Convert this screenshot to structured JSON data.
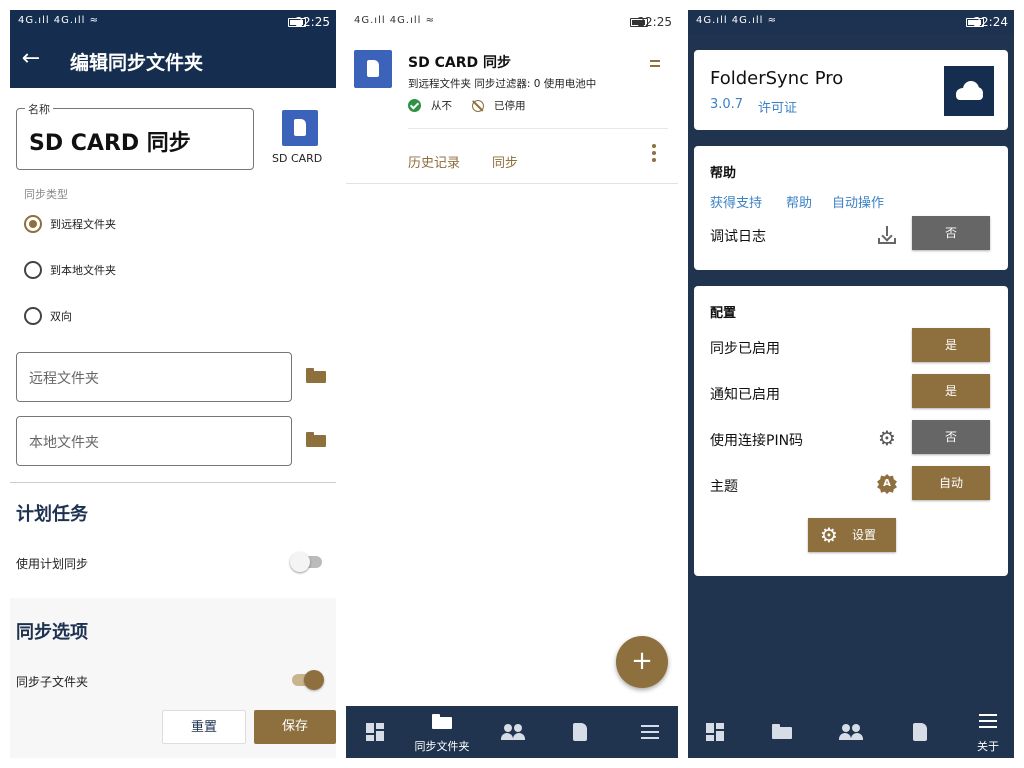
{
  "status": {
    "signal": "4G.ıll 4G.ıll ≈",
    "time_left": "22:25",
    "time_mid": "22:25",
    "time_right": "22:24"
  },
  "edit": {
    "title": "编辑同步文件夹",
    "name_label": "名称",
    "name_value": "SD CARD 同步",
    "icon_caption": "SD CARD",
    "sync_type_label": "同步类型",
    "radio_options": [
      "到远程文件夹",
      "到本地文件夹",
      "双向"
    ],
    "remote_folder_placeholder": "远程文件夹",
    "local_folder_placeholder": "本地文件夹",
    "schedule_heading": "计划任务",
    "use_schedule_label": "使用计划同步",
    "sync_options_heading": "同步选项",
    "sync_subfolders_label": "同步子文件夹",
    "reset_label": "重置",
    "save_label": "保存",
    "selected_radio": "到远程文件夹",
    "use_schedule_on": false,
    "sync_subfolders_on": true
  },
  "list": {
    "item": {
      "name": "SD CARD 同步",
      "subtitle": "到远程文件夹   同步过滤器: 0   使用电池中",
      "last_sync": "从不",
      "schedule": "已停用",
      "history": "历史记录",
      "sync": "同步"
    },
    "fab": "+"
  },
  "nav": {
    "folders_label": "同步文件夹",
    "about_label": "关于"
  },
  "about": {
    "app_name": "FolderSync Pro",
    "version": "3.0.7",
    "license": "许可证",
    "help_heading": "帮助",
    "help_links": [
      "获得支持",
      "帮助",
      "自动操作"
    ],
    "debug_log_label": "调试日志",
    "debug_log_value": "否",
    "config_heading": "配置",
    "sync_enabled_label": "同步已启用",
    "sync_enabled_value": "是",
    "notify_enabled_label": "通知已启用",
    "notify_enabled_value": "是",
    "pin_label": "使用连接PIN码",
    "pin_value": "否",
    "theme_label": "主题",
    "theme_value": "自动",
    "settings_label": "设置"
  },
  "colors": {
    "navy": "#152d4f",
    "accent": "#8e6f3e",
    "link": "#3b82c4",
    "icon_blue": "#3b63b9"
  }
}
